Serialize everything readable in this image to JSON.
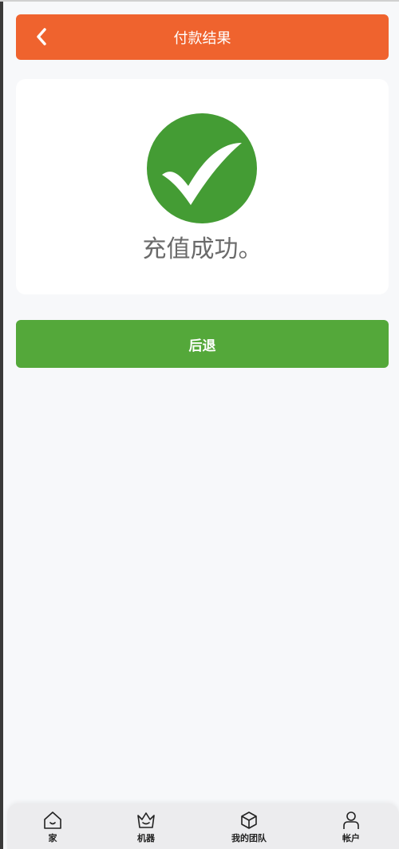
{
  "header": {
    "title": "付款结果",
    "back_icon": "chevron-left-icon"
  },
  "result": {
    "icon": "checkmark-circle-icon",
    "icon_color": "#449c34",
    "message": "充值成功。"
  },
  "actions": {
    "back_label": "后退",
    "back_color": "#54a83a"
  },
  "tabbar": {
    "items": [
      {
        "label": "家",
        "icon": "home-icon"
      },
      {
        "label": "机器",
        "icon": "crown-icon"
      },
      {
        "label": "我的团队",
        "icon": "cube-icon"
      },
      {
        "label": "帐户",
        "icon": "user-icon"
      }
    ]
  },
  "colors": {
    "header_bg": "#ef632e",
    "page_bg": "#f7f8fa"
  }
}
